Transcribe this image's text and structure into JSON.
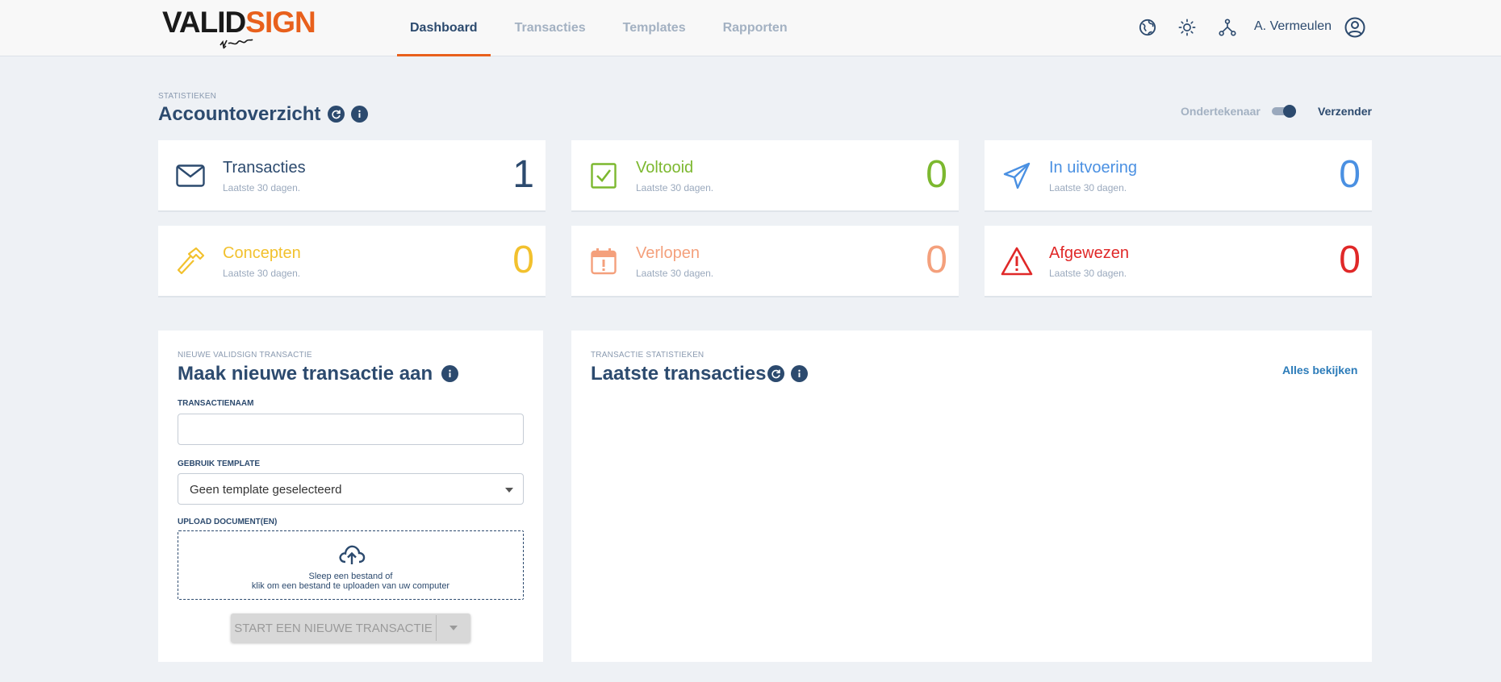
{
  "header": {
    "logo": {
      "part1": "VALID",
      "part2": "SIGN"
    },
    "nav": [
      {
        "label": "Dashboard",
        "active": true
      },
      {
        "label": "Transacties",
        "active": false
      },
      {
        "label": "Templates",
        "active": false
      },
      {
        "label": "Rapporten",
        "active": false
      }
    ],
    "icons": [
      "globe-icon",
      "sun-icon",
      "network-icon",
      "user-circle-icon"
    ],
    "user_name": "A. Vermeulen"
  },
  "overview": {
    "label": "STATISTIEKEN",
    "title": "Accountoverzicht",
    "toggle": {
      "left_label": "Ondertekenaar",
      "right_label": "Verzender",
      "selected": "Verzender"
    }
  },
  "stats": [
    {
      "title": "Transacties",
      "sub": "Laatste 30 dagen.",
      "value": "1",
      "color": "#2c4a6e",
      "icon": "envelope-icon"
    },
    {
      "title": "Voltooid",
      "sub": "Laatste 30 dagen.",
      "value": "0",
      "color": "#7cb82f",
      "icon": "checkbox-icon"
    },
    {
      "title": "In uitvoering",
      "sub": "Laatste 30 dagen.",
      "value": "0",
      "color": "#4a90e2",
      "icon": "paper-plane-icon"
    },
    {
      "title": "Concepten",
      "sub": "Laatste 30 dagen.",
      "value": "0",
      "color": "#f2c12e",
      "icon": "hammer-icon"
    },
    {
      "title": "Verlopen",
      "sub": "Laatste 30 dagen.",
      "value": "0",
      "color": "#f4a07c",
      "icon": "calendar-alert-icon"
    },
    {
      "title": "Afgewezen",
      "sub": "Laatste 30 dagen.",
      "value": "0",
      "color": "#e02828",
      "icon": "warning-icon"
    }
  ],
  "new_transaction": {
    "label": "NIEUWE VALIDSIGN TRANSACTIE",
    "title": "Maak nieuwe transactie aan",
    "name_label": "TRANSACTIENAAM",
    "name_value": "",
    "template_label": "GEBRUIK TEMPLATE",
    "template_value": "Geen template geselecteerd",
    "upload_label": "UPLOAD DOCUMENT(EN)",
    "upload_line1": "Sleep een bestand of",
    "upload_line2": "klik om een bestand te uploaden van uw computer",
    "start_button": "START EEN NIEUWE TRANSACTIE"
  },
  "latest": {
    "label": "TRANSACTIE STATISTIEKEN",
    "title": "Laatste transacties",
    "view_all": "Alles bekijken"
  }
}
